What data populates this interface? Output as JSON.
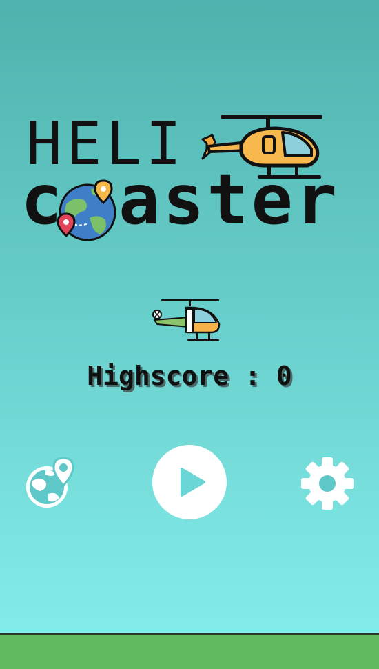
{
  "title": {
    "line1": "HELI",
    "line2_start": "c",
    "line2_end": "aster"
  },
  "highscore": {
    "label": "Highscore",
    "separator": ":",
    "value": "0"
  },
  "icons": {
    "title_helicopter": "helicopter-icon",
    "title_globe": "globe-map-pin-icon",
    "player": "helicopter-icon",
    "map_button": "globe-location-icon",
    "play_button": "play-icon",
    "settings_button": "gear-icon"
  },
  "colors": {
    "sky_top": "#4fb2ad",
    "sky_bottom": "#83ecea",
    "ground": "#5fba5f",
    "heli_body": "#f7b84d",
    "heli_window": "#8ecfdc",
    "player_body": "#f5b24a",
    "player_tail": "#8bc46a",
    "globe_ocean": "#3e7fc7",
    "globe_land": "#7cc06a",
    "pin_red": "#e0455a",
    "pin_yellow": "#f5b84a",
    "button_white": "#ffffff"
  }
}
